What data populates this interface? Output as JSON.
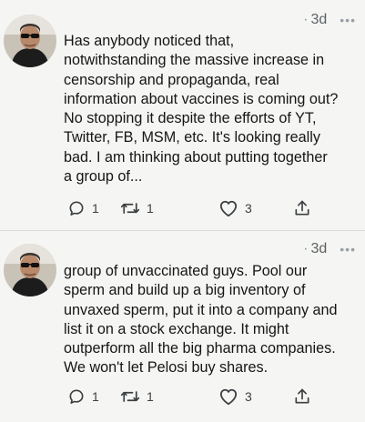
{
  "tweets": [
    {
      "time_sep": "·",
      "time": "3d",
      "more": "•••",
      "text": "Has anybody noticed that,\nnotwithstanding the massive increase in\ncensorship and propaganda, real\ninformation about vaccines is coming out?\nNo stopping it despite the efforts of YT,\nTwitter, FB, MSM, etc. It's looking really\nbad. I am thinking about putting together\na group of...",
      "replies": "1",
      "retweets": "1",
      "likes": "3"
    },
    {
      "time_sep": "·",
      "time": "3d",
      "more": "•••",
      "text": "group of unvaccinated guys. Pool our\nsperm and build up a big inventory of\nunvaxed sperm, put it into a company and\nlist it on a stock exchange. It might\noutperform all the big pharma companies.\nWe won't let Pelosi buy shares.",
      "replies": "1",
      "retweets": "1",
      "likes": "3"
    }
  ],
  "icons": {
    "avatar": "avatar",
    "reply": "reply-icon",
    "retweet": "retweet-icon",
    "like": "like-icon",
    "share": "share-icon",
    "more": "more-icon"
  },
  "colors": {
    "background": "#f5f6f3",
    "text": "#151515",
    "muted": "#5b6167",
    "icon": "#3c4043"
  }
}
